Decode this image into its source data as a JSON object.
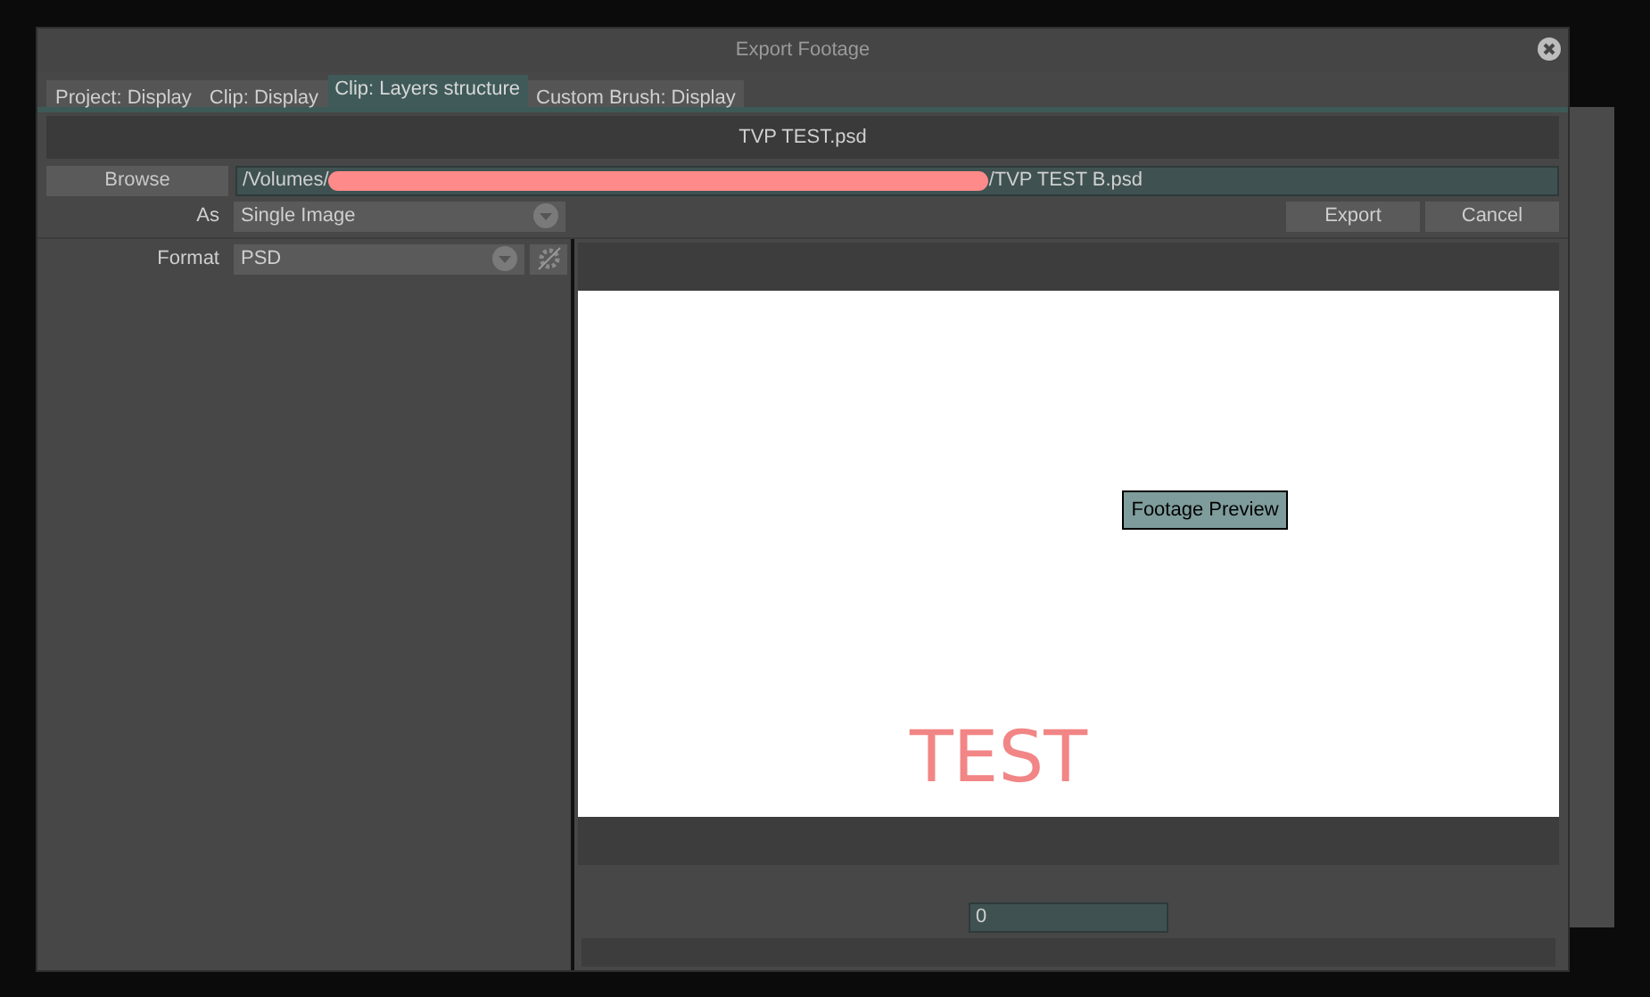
{
  "window": {
    "title": "Export Footage"
  },
  "tabs": [
    {
      "label": "Project: Display",
      "selected": false
    },
    {
      "label": "Clip: Display",
      "selected": false
    },
    {
      "label": "Clip: Layers structure",
      "selected": true
    },
    {
      "label": "Custom Brush: Display",
      "selected": false
    }
  ],
  "file_name": "TVP TEST.psd",
  "browse_button": "Browse",
  "path": {
    "start": "/Volumes/",
    "end": "/TVP TEST B.psd",
    "redacted": true
  },
  "as": {
    "label": "As",
    "value": "Single Image"
  },
  "buttons": [
    "Export",
    "Cancel"
  ],
  "format": {
    "label": "Format",
    "value": "PSD"
  },
  "preview": {
    "button": "Footage Preview",
    "sketch_text": "TEST"
  },
  "frame_field": {
    "value": "0"
  }
}
